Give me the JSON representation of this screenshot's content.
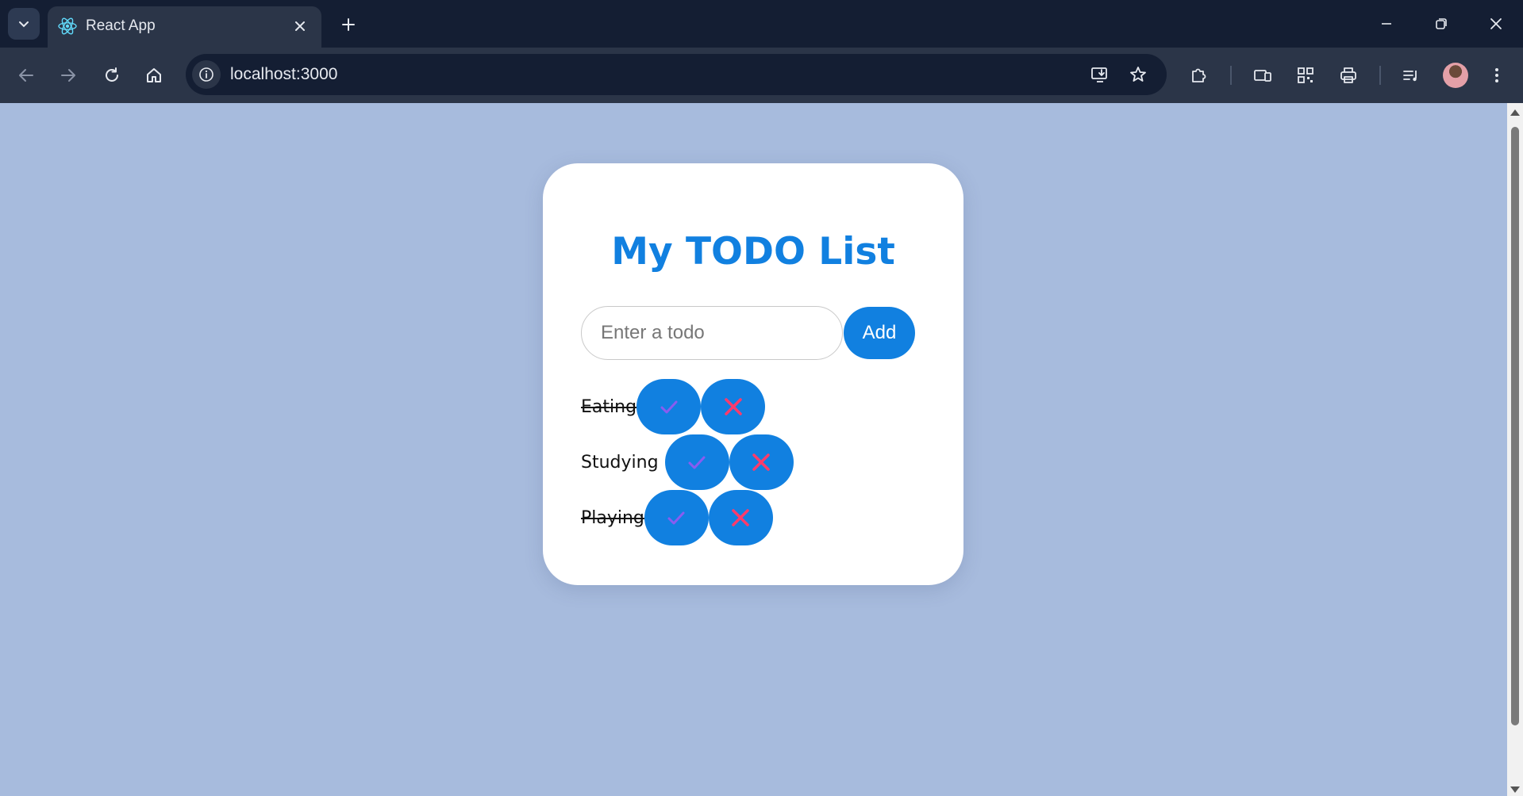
{
  "browser": {
    "tab_title": "React App",
    "url": "localhost:3000"
  },
  "app": {
    "title": "My TODO List",
    "input_placeholder": "Enter a todo",
    "add_label": "Add",
    "todos": [
      {
        "text": "Eating",
        "completed": true
      },
      {
        "text": "Studying",
        "completed": false
      },
      {
        "text": "Playing",
        "completed": true
      }
    ]
  },
  "colors": {
    "page_background": "#a7bbdd",
    "accent": "#1180e0",
    "check_icon": "#8a5cf0",
    "delete_icon": "#ff3b6b"
  }
}
